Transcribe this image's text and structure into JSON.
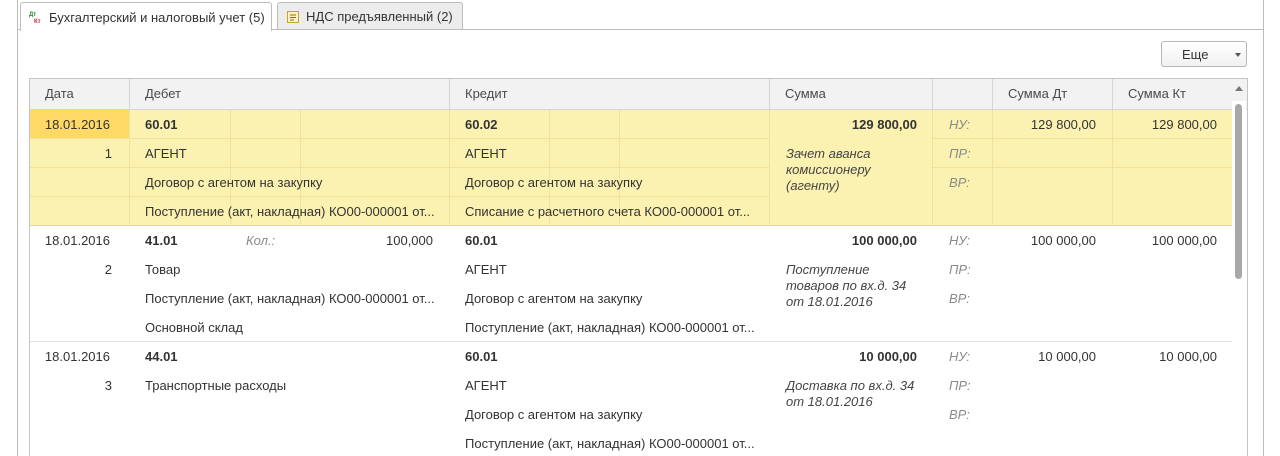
{
  "tabs": [
    {
      "label": "Бухгалтерский и налоговый учет (5)",
      "icon": "dt-kt-icon"
    },
    {
      "label": "НДС предъявленный (2)",
      "icon": "document-icon"
    }
  ],
  "toolbar": {
    "more_label": "Еще"
  },
  "columns": {
    "date": "Дата",
    "debit": "Дебет",
    "credit": "Кредит",
    "sum": "Сумма",
    "sum_dt": "Сумма Дт",
    "sum_kt": "Сумма Кт"
  },
  "rows": [
    {
      "date": "18.01.2016",
      "num": "1",
      "debit_account": "60.01",
      "debit_qty_label": "",
      "debit_qty": "",
      "debit_sub": [
        "АГЕНТ",
        "Договор с агентом на закупку",
        "Поступление (акт, накладная) КО00-000001 от..."
      ],
      "credit_account": "60.02",
      "credit_sub": [
        "АГЕНТ",
        "Договор с агентом на закупку",
        "Списание с расчетного счета КО00-000001 от..."
      ],
      "sum": "129 800,00",
      "content": [
        "Зачет аванса",
        "комиссионеру",
        "(агенту)"
      ],
      "labels": [
        "НУ:",
        "ПР:",
        "ВР:"
      ],
      "sum_dt": "129 800,00",
      "sum_kt": "129 800,00"
    },
    {
      "date": "18.01.2016",
      "num": "2",
      "debit_account": "41.01",
      "debit_qty_label": "Кол.:",
      "debit_qty": "100,000",
      "debit_sub": [
        "Товар",
        "Поступление (акт, накладная) КО00-000001 от...",
        "Основной склад"
      ],
      "credit_account": "60.01",
      "credit_sub": [
        "АГЕНТ",
        "Договор с агентом на закупку",
        "Поступление (акт, накладная) КО00-000001 от..."
      ],
      "sum": "100 000,00",
      "content": [
        "Поступление",
        "товаров по вх.д. 34",
        "от 18.01.2016"
      ],
      "labels": [
        "НУ:",
        "ПР:",
        "ВР:"
      ],
      "sum_dt": "100 000,00",
      "sum_kt": "100 000,00"
    },
    {
      "date": "18.01.2016",
      "num": "3",
      "debit_account": "44.01",
      "debit_qty_label": "",
      "debit_qty": "",
      "debit_sub": [
        "Транспортные расходы",
        "",
        ""
      ],
      "credit_account": "60.01",
      "credit_sub": [
        "АГЕНТ",
        "Договор с агентом на закупку",
        "Поступление (акт, накладная) КО00-000001 от..."
      ],
      "sum": "10 000,00",
      "content": [
        "Доставка по вх.д. 34",
        "от 18.01.2016",
        ""
      ],
      "labels": [
        "НУ:",
        "ПР:",
        "ВР:"
      ],
      "sum_dt": "10 000,00",
      "sum_kt": "10 000,00"
    }
  ]
}
